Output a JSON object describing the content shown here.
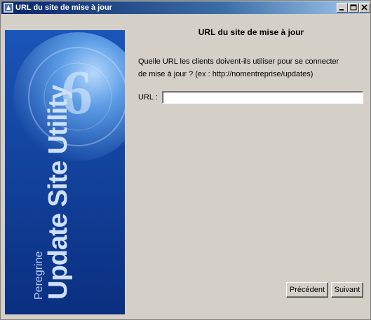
{
  "window": {
    "title": "URL du site de mise à jour"
  },
  "side_panel": {
    "brand": "Peregrine",
    "product": "Update Site Utility",
    "badge_number": "6",
    "colors": {
      "background": "#0e3f9c",
      "highlight": "#5fa0e8"
    }
  },
  "main": {
    "heading": "URL du site de mise à jour",
    "description_line1": "Quelle URL les clients doivent-ils utiliser pour se connecter",
    "description_line2": "de mise à jour ? (ex : http://nomentreprise/updates)",
    "url_label": "URL :",
    "url_value": ""
  },
  "buttons": {
    "previous_label": "Précédent",
    "next_label": "Suivant"
  }
}
